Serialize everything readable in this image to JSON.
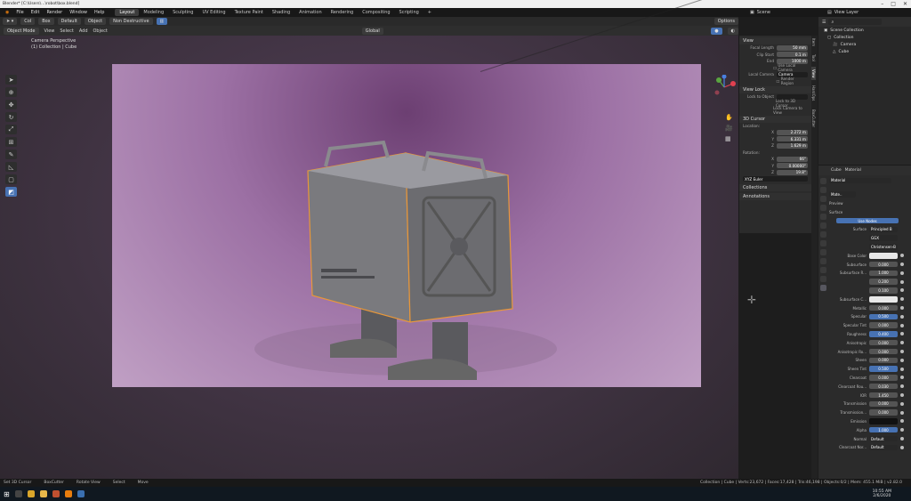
{
  "window": {
    "title": "Blender* [C:\\Users\\...\\robot\\box.blend]"
  },
  "menu": [
    "File",
    "Edit",
    "Render",
    "Window",
    "Help"
  ],
  "workspaces": [
    "Layout",
    "Modeling",
    "Sculpting",
    "UV Editing",
    "Texture Paint",
    "Shading",
    "Animation",
    "Rendering",
    "Compositing",
    "Scripting",
    "+"
  ],
  "scene": {
    "label": "Scene"
  },
  "view_layer": {
    "label": "View Layer"
  },
  "tool_header": {
    "col": "Col",
    "box": "Box",
    "default": "Default",
    "object": "Object",
    "non_destructive": "Non Destructive",
    "options": "Options"
  },
  "viewport_header": {
    "mode": "Object Mode",
    "items": [
      "View",
      "Select",
      "Add",
      "Object"
    ],
    "transform": "Global"
  },
  "viewport": {
    "line1": "Camera Perspective",
    "line2": "(1) Collection | Cube"
  },
  "npanel": {
    "view_section": "View",
    "focal_length": {
      "label": "Focal Length",
      "value": "50 mm"
    },
    "clip_start": {
      "label": "Clip Start",
      "value": "0.1 m"
    },
    "clip_end": {
      "label": "End",
      "value": "1000 m"
    },
    "use_local_camera": "Use Local Camera",
    "local_camera": {
      "label": "Local Camera",
      "value": "Camera"
    },
    "render_region": "Render Region",
    "view_lock": "View Lock",
    "lock_to_object": "Lock to Object",
    "lock_to_cursor": "Lock to 3D Cursor",
    "lock_camera": "Lock Camera to View",
    "cursor_section": "3D Cursor",
    "location": "Location:",
    "loc": [
      {
        "axis": "X",
        "value": "2.272 m"
      },
      {
        "axis": "Y",
        "value": "6.331 m"
      },
      {
        "axis": "Z",
        "value": "1.629 m"
      }
    ],
    "rotation": "Rotation:",
    "rot": [
      {
        "axis": "X",
        "value": "66°"
      },
      {
        "axis": "Y",
        "value": "0.00000°"
      },
      {
        "axis": "Z",
        "value": "19.8°"
      }
    ],
    "rot_mode": "XYZ Euler",
    "collections": "Collections",
    "annotations": "Annotations"
  },
  "ntabs": [
    "Item",
    "Tool",
    "View",
    "HardOps",
    "BoxCutter"
  ],
  "outliner": {
    "title": "Scene Collection",
    "rows": [
      "Collection",
      "Camera",
      "Cube"
    ]
  },
  "properties": {
    "object": "Cube",
    "material_tab": "Material",
    "material_slot": "Material",
    "mat_name": "Mate..",
    "preview": "Preview",
    "surface": "Surface",
    "use_nodes": "Use Nodes",
    "surface_row": {
      "label": "Surface",
      "value": "Principled B"
    },
    "dist": "GGX",
    "sss_method": "Christensen-B",
    "rows": [
      {
        "label": "Base Color",
        "value": "",
        "kind": "white"
      },
      {
        "label": "Subsurface",
        "value": "0.000",
        "kind": "grey"
      },
      {
        "label": "Subsurface R...",
        "value": "1.000",
        "kind": "grey"
      },
      {
        "label": "",
        "value": "0.200",
        "kind": "grey"
      },
      {
        "label": "",
        "value": "0.100",
        "kind": "grey"
      },
      {
        "label": "Subsurface C...",
        "value": "",
        "kind": "white"
      },
      {
        "label": "Metallic",
        "value": "0.000",
        "kind": "grey"
      },
      {
        "label": "Specular",
        "value": "0.500",
        "kind": "blue"
      },
      {
        "label": "Specular Tint",
        "value": "0.000",
        "kind": "grey"
      },
      {
        "label": "Roughness",
        "value": "0.400",
        "kind": "blue"
      },
      {
        "label": "Anisotropic",
        "value": "0.000",
        "kind": "grey"
      },
      {
        "label": "Anisotropic Ro...",
        "value": "0.000",
        "kind": "grey"
      },
      {
        "label": "Sheen",
        "value": "0.000",
        "kind": "grey"
      },
      {
        "label": "Sheen Tint",
        "value": "0.500",
        "kind": "blue"
      },
      {
        "label": "Clearcoat",
        "value": "0.000",
        "kind": "grey"
      },
      {
        "label": "Clearcoat Rou...",
        "value": "0.030",
        "kind": "grey"
      },
      {
        "label": "IOR",
        "value": "1.450",
        "kind": "grey"
      },
      {
        "label": "Transmission",
        "value": "0.000",
        "kind": "grey"
      },
      {
        "label": "Transmission...",
        "value": "0.000",
        "kind": "grey"
      },
      {
        "label": "Emission",
        "value": "",
        "kind": "black"
      },
      {
        "label": "Alpha",
        "value": "1.000",
        "kind": "blue"
      },
      {
        "label": "Normal",
        "value": "Default",
        "kind": "dd"
      },
      {
        "label": "Clearcoat Nor...",
        "value": "Default",
        "kind": "dd"
      }
    ]
  },
  "status": {
    "set_cursor": "Set 3D Cursor",
    "boxcutter": "BoxCutter",
    "rotate": "Rotate View",
    "select": "Select",
    "move": "Move",
    "stats": "Collection | Cube | Verts:23,672 | Faces:17,428 | Tris:46,198 | Objects:0/2 | Mem: 455.1 MiB | v2.82.0"
  },
  "clock": {
    "time": "10:55 AM",
    "date": "2/6/2020"
  }
}
